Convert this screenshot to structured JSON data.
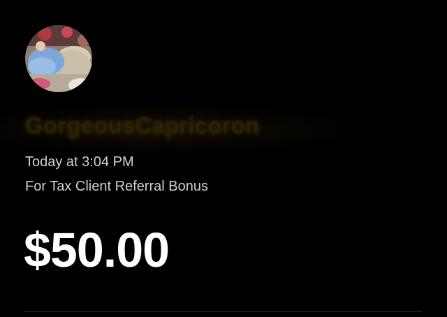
{
  "recipient": {
    "display_name": "GorgeousCapricoron"
  },
  "payment": {
    "timestamp": "Today at 3:04 PM",
    "memo": "For Tax Client Referral Bonus",
    "amount": "$50.00"
  },
  "colors": {
    "background": "#000000",
    "amount_text": "#ffffff",
    "secondary_text": "#cfcfcf",
    "name_text_faded": "#2a2305",
    "divider": "#2b2b2b"
  }
}
